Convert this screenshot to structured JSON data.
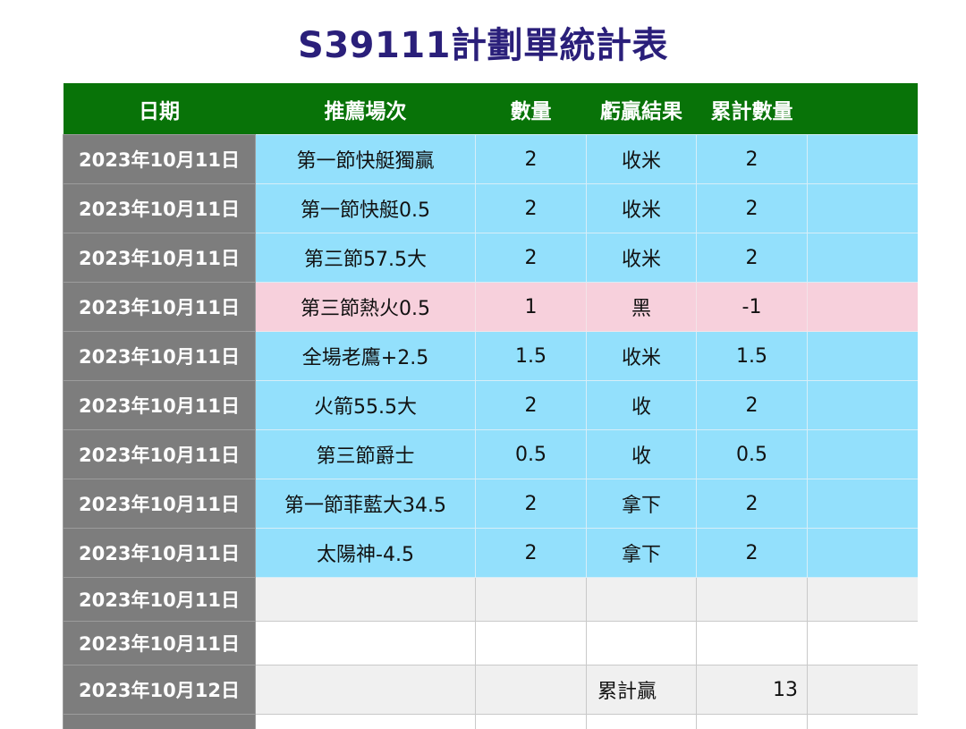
{
  "title": "S39111計劃單統計表",
  "headers": {
    "date": "日期",
    "recommendation": "推薦場次",
    "quantity": "數量",
    "result": "虧贏結果",
    "cumulative": "累計數量",
    "extra": ""
  },
  "rows": [
    {
      "date": "2023年10月11日",
      "recommendation": "第一節快艇獨贏",
      "quantity": "2",
      "result": "收米",
      "cumulative": "2"
    },
    {
      "date": "2023年10月11日",
      "recommendation": "第一節快艇0.5",
      "quantity": "2",
      "result": "收米",
      "cumulative": "2"
    },
    {
      "date": "2023年10月11日",
      "recommendation": "第三節57.5大",
      "quantity": "2",
      "result": "收米",
      "cumulative": "2"
    },
    {
      "date": "2023年10月11日",
      "recommendation": "第三節熱火0.5",
      "quantity": "1",
      "result": "黑",
      "cumulative": "-1"
    },
    {
      "date": "2023年10月11日",
      "recommendation": "全場老鷹+2.5",
      "quantity": "1.5",
      "result": "收米",
      "cumulative": "1.5"
    },
    {
      "date": "2023年10月11日",
      "recommendation": "火箭55.5大",
      "quantity": "2",
      "result": "收",
      "cumulative": "2"
    },
    {
      "date": "2023年10月11日",
      "recommendation": "第三節爵士",
      "quantity": "0.5",
      "result": "收",
      "cumulative": "0.5"
    },
    {
      "date": "2023年10月11日",
      "recommendation": "第一節菲藍大34.5",
      "quantity": "2",
      "result": "拿下",
      "cumulative": "2"
    },
    {
      "date": "2023年10月11日",
      "recommendation": "太陽神-4.5",
      "quantity": "2",
      "result": "拿下",
      "cumulative": "2"
    },
    {
      "date": "2023年10月11日",
      "recommendation": "",
      "quantity": "",
      "result": "",
      "cumulative": ""
    },
    {
      "date": "2023年10月11日",
      "recommendation": "",
      "quantity": "",
      "result": "",
      "cumulative": ""
    },
    {
      "date": "2023年10月12日",
      "recommendation": "",
      "quantity": "",
      "result": "",
      "cumulative": ""
    },
    {
      "date": "",
      "recommendation": "",
      "quantity": "",
      "result": "",
      "cumulative": ""
    }
  ],
  "total": {
    "label": "累計贏",
    "value": "13"
  },
  "colors": {
    "header_bg": "#087308",
    "date_bg": "#7d7d7d",
    "win_bg": "#93e0fc",
    "loss_bg": "#f7d0dc",
    "title": "#2a1f7a"
  }
}
